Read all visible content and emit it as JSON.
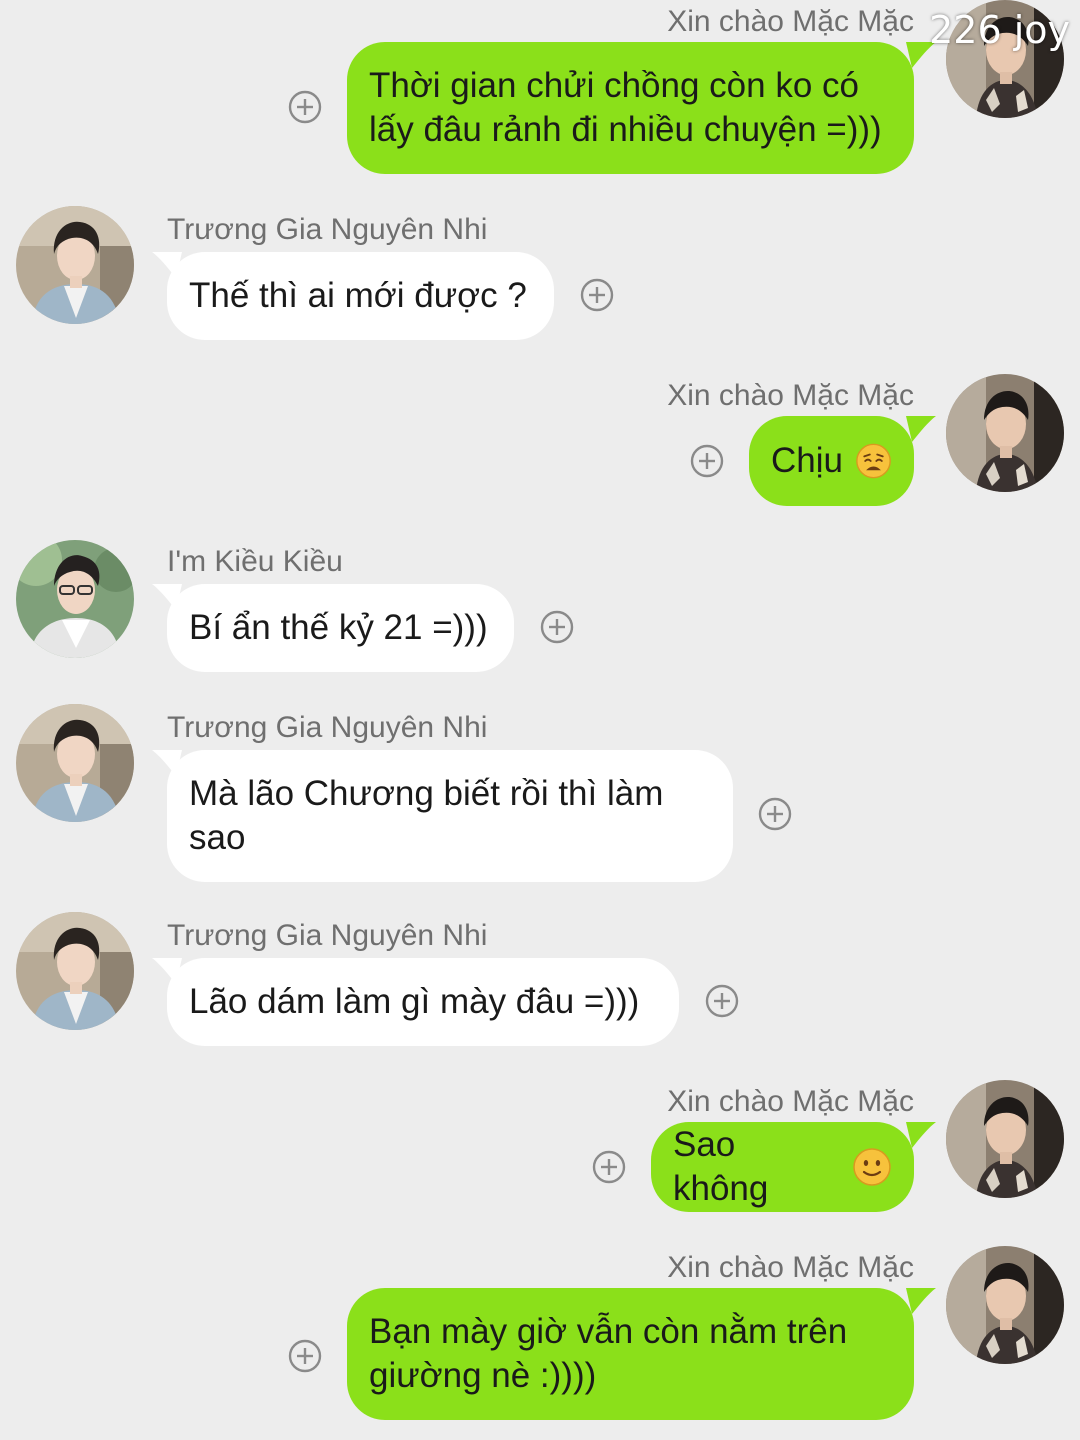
{
  "watermark": "226 joy",
  "messages": [
    {
      "sender": "Xin chào Mặc Mặc",
      "text": "Thời gian chửi chồng còn ko có\nlấy đâu rảnh đi nhiều chuyện =)))",
      "side": "right"
    },
    {
      "sender": "Trương Gia Nguyên Nhi",
      "text": "Thế thì ai mới được ?",
      "side": "left"
    },
    {
      "sender": "Xin chào Mặc Mặc",
      "text": "Chịu",
      "emoji": "weary-face-emoji",
      "side": "right"
    },
    {
      "sender": "I'm Kiều Kiều",
      "text": "Bí ẩn thế kỷ 21 =)))",
      "side": "left"
    },
    {
      "sender": "Trương Gia Nguyên Nhi",
      "text": "Mà lão Chương biết rồi thì làm\nsao",
      "side": "left"
    },
    {
      "sender": "Trương Gia Nguyên Nhi",
      "text": "Lão dám làm gì mày đâu =)))",
      "side": "left"
    },
    {
      "sender": "Xin chào Mặc Mặc",
      "text": "Sao không",
      "emoji": "slightly-smiling-face-emoji",
      "side": "right"
    },
    {
      "sender": "Xin chào Mặc Mặc",
      "text": "Bạn mày giờ vẫn còn nằm trên\ngiường nè :))))",
      "side": "right"
    }
  ],
  "colors": {
    "background": "#ededed",
    "sent_bubble": "#8be01a",
    "received_bubble": "#ffffff",
    "sender_name": "#6f6f6f"
  },
  "icons": {
    "add": "plus-circle-icon",
    "avatar": "user-avatar"
  }
}
